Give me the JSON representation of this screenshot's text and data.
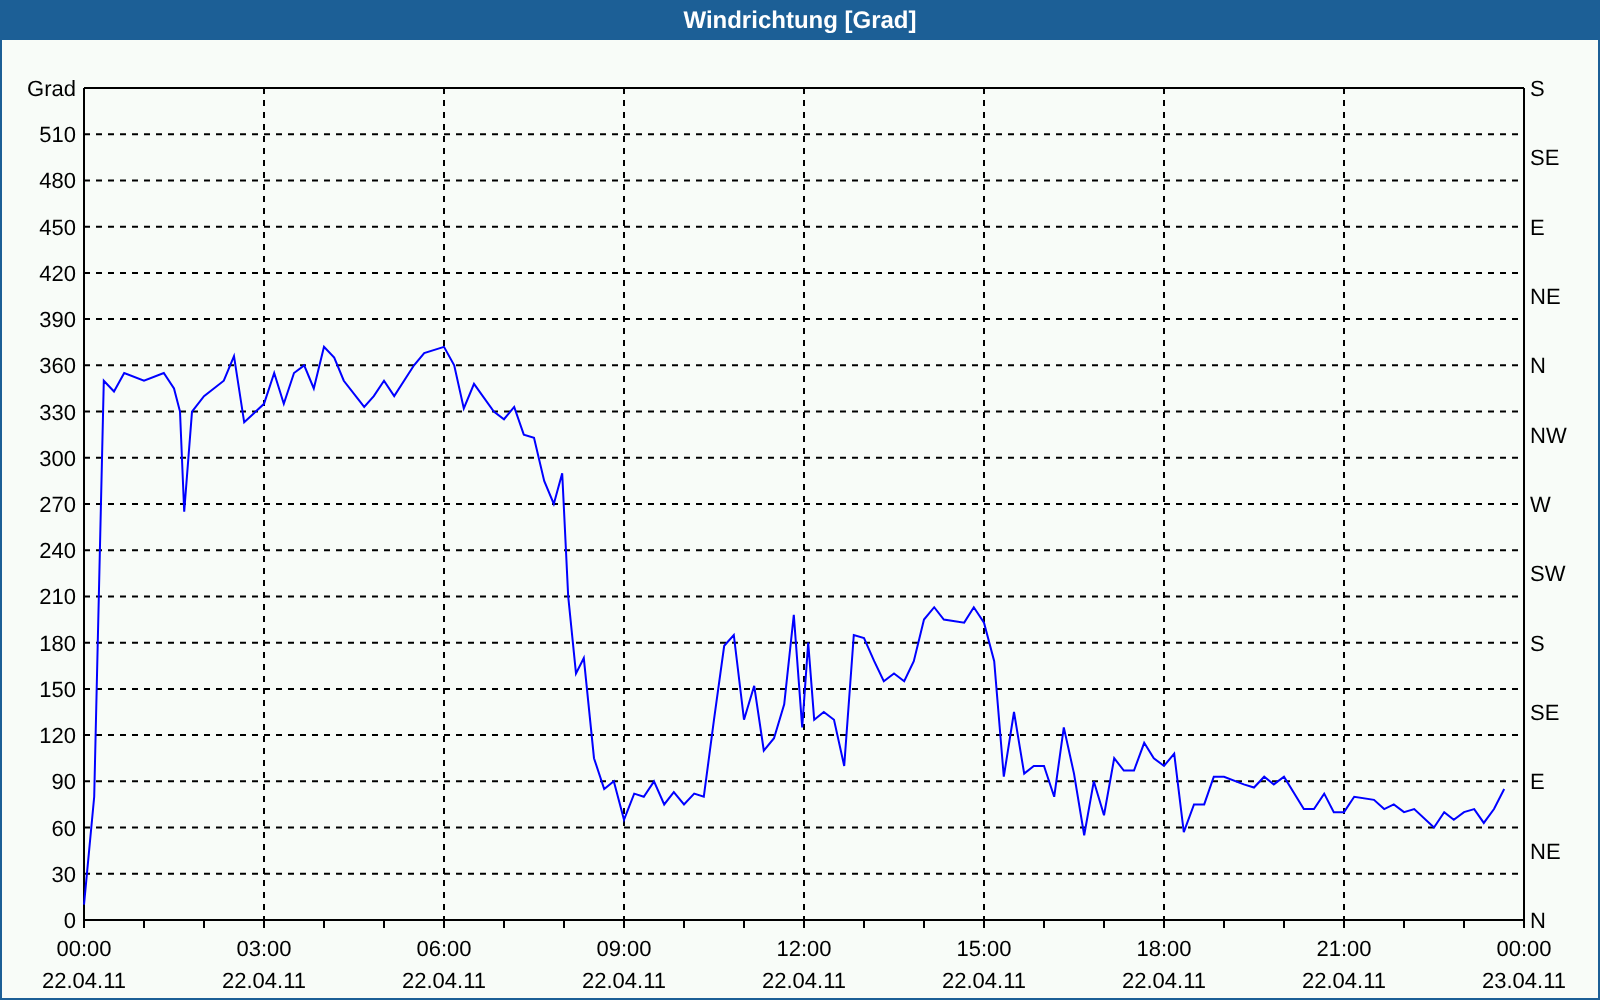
{
  "window": {
    "title": "Windrichtung [Grad]"
  },
  "chart": {
    "chart_data": {
      "type": "line",
      "grid": true,
      "ylabel": "Grad",
      "xlim": [
        0,
        24
      ],
      "ylim": [
        0,
        540
      ],
      "xticks": [
        {
          "value": 0,
          "label": "00:00"
        },
        {
          "value": 3,
          "label": "03:00"
        },
        {
          "value": 6,
          "label": "06:00"
        },
        {
          "value": 9,
          "label": "09:00"
        },
        {
          "value": 12,
          "label": "12:00"
        },
        {
          "value": 15,
          "label": "15:00"
        },
        {
          "value": 18,
          "label": "18:00"
        },
        {
          "value": 21,
          "label": "21:00"
        },
        {
          "value": 24,
          "label": "00:00"
        }
      ],
      "yticks": [
        0,
        30,
        60,
        90,
        120,
        150,
        180,
        210,
        240,
        270,
        300,
        330,
        360,
        390,
        420,
        450,
        480,
        510
      ],
      "x": [
        0,
        0.17,
        0.33,
        0.5,
        0.67,
        1,
        1.33,
        1.5,
        1.6,
        1.67,
        1.8,
        2,
        2.33,
        2.5,
        2.67,
        3,
        3.17,
        3.33,
        3.5,
        3.67,
        3.83,
        4,
        4.17,
        4.33,
        4.67,
        4.83,
        5,
        5.17,
        5.5,
        5.67,
        6,
        6.17,
        6.33,
        6.5,
        6.83,
        7,
        7.17,
        7.33,
        7.5,
        7.67,
        7.83,
        7.97,
        8.07,
        8.2,
        8.33,
        8.5,
        8.67,
        8.83,
        9,
        9.17,
        9.33,
        9.5,
        9.67,
        9.83,
        10,
        10.17,
        10.33,
        10.5,
        10.67,
        10.83,
        11,
        11.17,
        11.33,
        11.5,
        11.67,
        11.83,
        11.97,
        12.07,
        12.17,
        12.33,
        12.5,
        12.67,
        12.83,
        13,
        13.17,
        13.33,
        13.5,
        13.67,
        13.83,
        14,
        14.17,
        14.33,
        14.67,
        14.83,
        15,
        15.17,
        15.33,
        15.5,
        15.67,
        15.83,
        16,
        16.17,
        16.33,
        16.5,
        16.67,
        16.83,
        17,
        17.17,
        17.33,
        17.5,
        17.67,
        17.83,
        18,
        18.17,
        18.33,
        18.5,
        18.67,
        18.83,
        19,
        19.33,
        19.5,
        19.67,
        19.83,
        20,
        20.33,
        20.5,
        20.67,
        20.83,
        21,
        21.17,
        21.5,
        21.67,
        21.83,
        22,
        22.17,
        22.5,
        22.67,
        22.83,
        23,
        23.17,
        23.33,
        23.5,
        23.67
      ],
      "series": [
        {
          "color": "#0000ff",
          "values": [
            10,
            80,
            350,
            343,
            355,
            350,
            355,
            345,
            330,
            265,
            330,
            340,
            350,
            366,
            323,
            335,
            355,
            335,
            355,
            360,
            345,
            372,
            365,
            350,
            333,
            340,
            350,
            340,
            360,
            368,
            372,
            360,
            332,
            348,
            330,
            325,
            333,
            315,
            313,
            285,
            270,
            290,
            210,
            160,
            170,
            105,
            85,
            90,
            65,
            82,
            80,
            90,
            75,
            83,
            75,
            82,
            80,
            130,
            178,
            185,
            130,
            152,
            110,
            118,
            140,
            198,
            125,
            180,
            130,
            135,
            130,
            100,
            185,
            183,
            168,
            155,
            160,
            155,
            168,
            195,
            203,
            195,
            193,
            203,
            193,
            168,
            93,
            135,
            95,
            100,
            100,
            80,
            125,
            95,
            55,
            90,
            68,
            105,
            97,
            97,
            115,
            105,
            100,
            108,
            57,
            75,
            75,
            93,
            93,
            88,
            86,
            93,
            88,
            93,
            72,
            72,
            82,
            70,
            70,
            80,
            78,
            72,
            75,
            70,
            72,
            60,
            70,
            65,
            70,
            72,
            63,
            72,
            85
          ]
        }
      ]
    },
    "xtick_dates": [
      "22.04.11",
      "22.04.11",
      "22.04.11",
      "22.04.11",
      "22.04.11",
      "22.04.11",
      "22.04.11",
      "22.04.11",
      "23.04.11"
    ],
    "right_axis_labels": [
      "S",
      "SE",
      "E",
      "NE",
      "N",
      "NW",
      "W",
      "SW",
      "S",
      "SE",
      "E",
      "NE",
      "N"
    ]
  }
}
